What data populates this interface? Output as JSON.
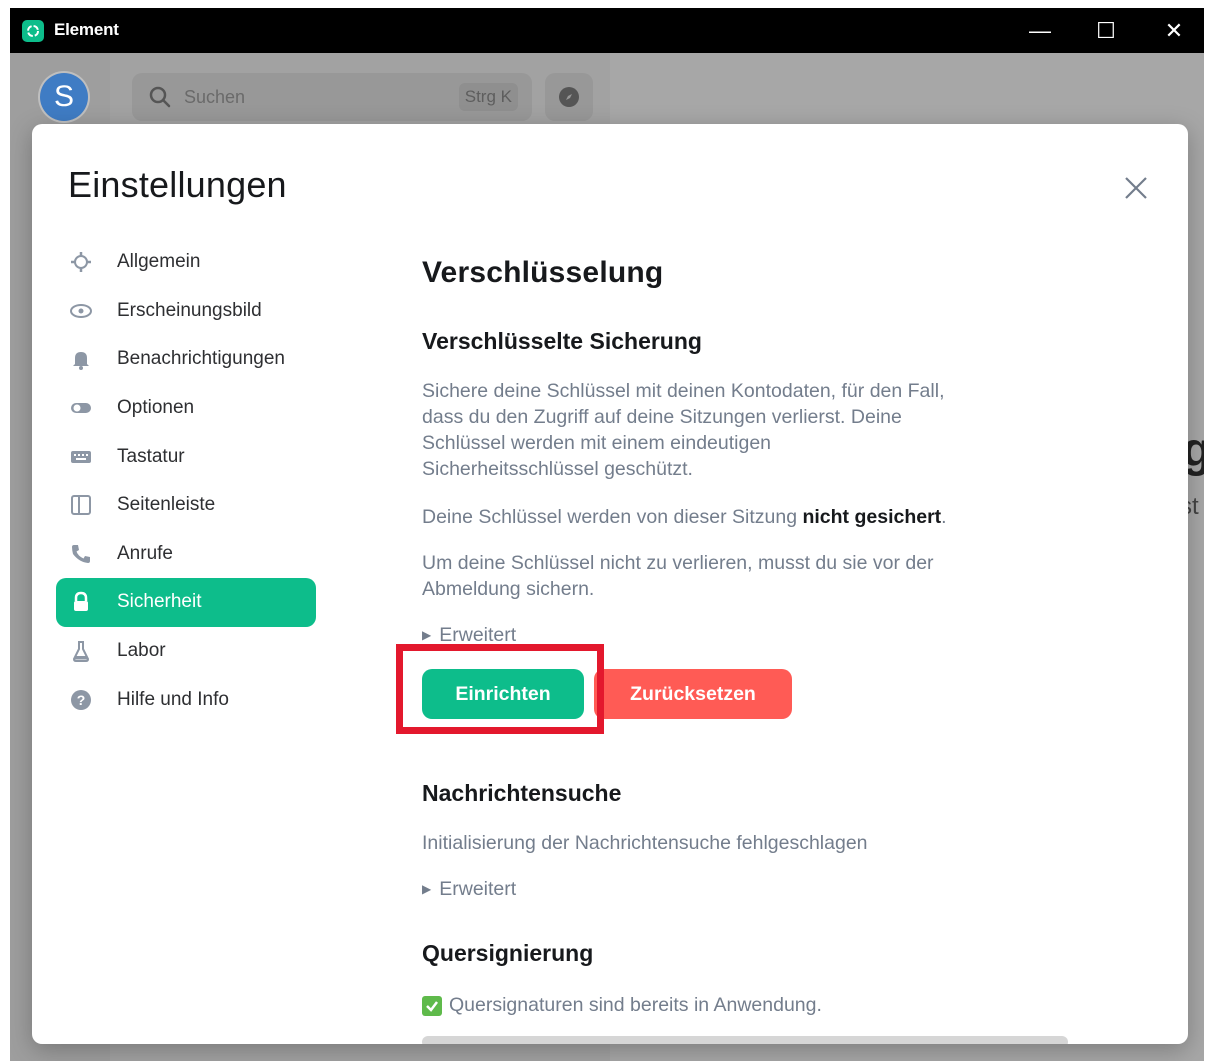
{
  "window": {
    "title": "Element",
    "controls": {
      "minimize": "—",
      "maximize": "☐",
      "close": "✕"
    }
  },
  "background": {
    "avatar_letter": "S",
    "search_placeholder": "Suchen",
    "search_shortcut": "Strg K",
    "right_peek_1": "g",
    "right_peek_2": "st"
  },
  "dialog": {
    "title": "Einstellungen",
    "close_label": "×"
  },
  "nav": {
    "items": [
      {
        "label": "Allgemein",
        "icon": "gear-icon"
      },
      {
        "label": "Erscheinungsbild",
        "icon": "eye-icon"
      },
      {
        "label": "Benachrichtigungen",
        "icon": "bell-icon"
      },
      {
        "label": "Optionen",
        "icon": "toggle-icon"
      },
      {
        "label": "Tastatur",
        "icon": "keyboard-icon"
      },
      {
        "label": "Seitenleiste",
        "icon": "sidebar-icon"
      },
      {
        "label": "Anrufe",
        "icon": "phone-icon"
      },
      {
        "label": "Sicherheit",
        "icon": "lock-icon",
        "active": true
      },
      {
        "label": "Labor",
        "icon": "flask-icon"
      },
      {
        "label": "Hilfe und Info",
        "icon": "help-icon"
      }
    ]
  },
  "content": {
    "heading": "Verschlüsselung",
    "backup": {
      "heading": "Verschlüsselte Sicherung",
      "desc_line1": "Sichere deine Schlüssel mit deinen Kontodaten, für den Fall,",
      "desc_line2": "dass du den Zugriff auf deine Sitzungen verlierst. Deine",
      "desc_line3": "Schlüssel werden mit einem eindeutigen",
      "desc_line4": "Sicherheitsschlüssel geschützt.",
      "status_prefix": "Deine Schlüssel werden von dieser Sitzung ",
      "status_bold": "nicht gesichert",
      "status_suffix": ".",
      "warn_line1": "Um deine Schlüssel nicht zu verlieren, musst du sie vor der",
      "warn_line2": "Abmeldung sichern.",
      "advanced": "Erweitert",
      "setup_button": "Einrichten",
      "reset_button": "Zurücksetzen"
    },
    "search": {
      "heading": "Nachrichtensuche",
      "desc": "Initialisierung der Nachrichtensuche fehlgeschlagen",
      "advanced": "Erweitert"
    },
    "cross_signing": {
      "heading": "Quersignierung",
      "status": "Quersignaturen sind bereits in Anwendung."
    }
  },
  "colors": {
    "accent": "#0dbd8b",
    "danger": "#ff5b55",
    "highlight": "#e3182d"
  }
}
